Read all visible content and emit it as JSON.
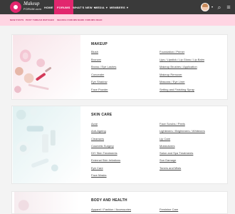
{
  "header": {
    "logo_title": "Makeup",
    "logo_subtitle": "FORUM.com",
    "nav": [
      {
        "label": "HOME"
      },
      {
        "label": "FORUMS"
      },
      {
        "label": "WHAT'S NEW"
      },
      {
        "label": "MEDIA"
      },
      {
        "label": "MEMBERS"
      }
    ],
    "icons": [
      "search-icon",
      "menu-icon"
    ]
  },
  "subnav": [
    "NEW POSTS",
    "POST THREAD",
    "WATCHED",
    "SEARCH FORUMS",
    "MARK FORUMS READ"
  ],
  "sections": [
    {
      "title": "MAKEUP",
      "left": [
        "Blush",
        "Bronzer",
        "Brows / Eye Lashes",
        "Concealer",
        "Eye Shadow",
        "Face Powder"
      ],
      "right": [
        "Foundation / Primer",
        "Lips / Lipstick / Lip Gloss / Lip Balm",
        "Makeup Brushes / Application",
        "Makeup Remover",
        "Mascara / Eye Liner",
        "Setting and Finishing Spray"
      ]
    },
    {
      "title": "SKIN CARE",
      "left": [
        "Acne",
        "Anti-Ageing",
        "Cleansers",
        "Cosmetic Surgery",
        "DIY Skin Treatments",
        "External Skin Irritations",
        "Eye Care",
        "Face Masks"
      ],
      "right": [
        "Face Scrubs / Peels",
        "Lighteners / Brighteners / Whiteners",
        "Lip Care",
        "Moisturizers",
        "Salon and Spa Treatments",
        "Sun Damage",
        "Toners and Mists"
      ]
    },
    {
      "title": "BODY AND HEALTH",
      "left": [
        "Apparel / Fashion / Accessories"
      ],
      "right": [
        "Feminine Care"
      ]
    }
  ],
  "colors": {
    "brand": "#e2266e",
    "topbar": "#3a3a3a",
    "subbar": "#ffd5e3",
    "link": "#444444"
  }
}
